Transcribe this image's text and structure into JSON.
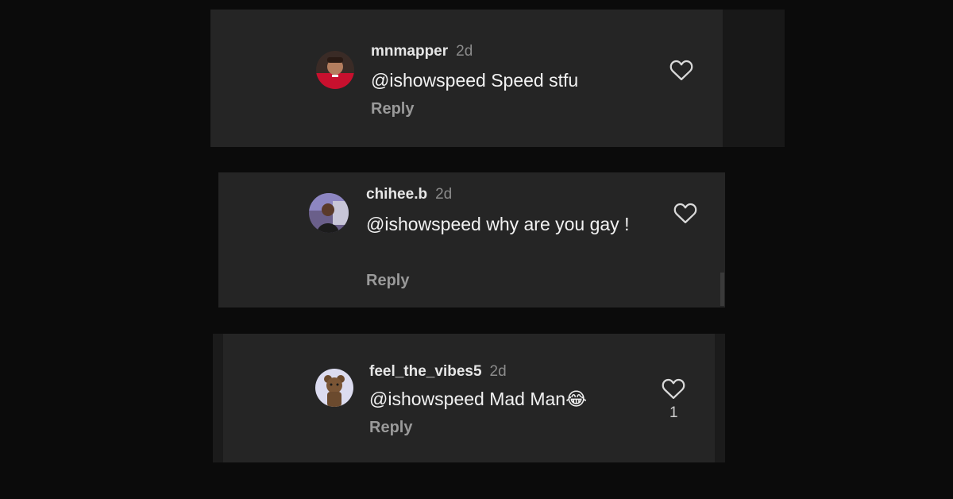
{
  "comments": [
    {
      "username": "mnmapper",
      "time": "2d",
      "text": "@ishowspeed Speed stfu",
      "reply_label": "Reply",
      "avatar_icon": "football-player-avatar"
    },
    {
      "username": "chihee.b",
      "time": "2d",
      "text": "@ishowspeed why are you gay !",
      "reply_label": "Reply",
      "avatar_icon": "person-photo-avatar"
    },
    {
      "username": "feel_the_vibes5",
      "time": "2d",
      "text": "@ishowspeed Mad Man😂",
      "reply_label": "Reply",
      "like_count": "1",
      "avatar_icon": "teddy-bear-avatar"
    }
  ],
  "colors": {
    "background": "#0b0b0b",
    "card": "#252525",
    "username": "#e6e6e6",
    "meta": "#8c8c8c",
    "text": "#f2f2f2"
  },
  "icons": {
    "like": "heart-outline-icon"
  }
}
